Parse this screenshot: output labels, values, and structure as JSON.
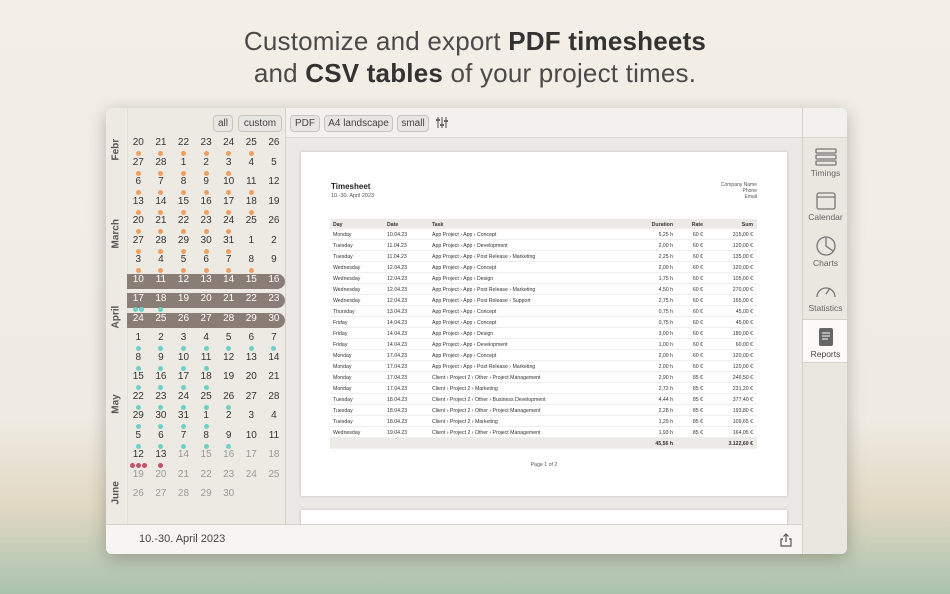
{
  "headline": {
    "l1_a": "Customize and export ",
    "l1_b": "PDF timesheets",
    "l2_a": "and ",
    "l2_b": "CSV tables",
    "l2_c": " of your project times."
  },
  "calendar": {
    "months": [
      "Febr",
      "March",
      "April",
      "May",
      "June"
    ],
    "range_label": "10.-30. April 2023",
    "filter": {
      "all": "all",
      "custom": "custom"
    },
    "weeks": [
      {
        "days": [
          "20",
          "21",
          "22",
          "23",
          "24",
          "25",
          "26"
        ],
        "dots": [
          "o",
          "o",
          "o",
          "o",
          "o",
          "o",
          ""
        ]
      },
      {
        "days": [
          "27",
          "28",
          "1",
          "2",
          "3",
          "4",
          "5"
        ],
        "dots": [
          "o",
          "o",
          "o",
          "o",
          "o",
          "",
          ""
        ],
        "dim": [
          false,
          false,
          false,
          false,
          false,
          false,
          false
        ]
      },
      {
        "days": [
          "6",
          "7",
          "8",
          "9",
          "10",
          "11",
          "12"
        ],
        "dots": [
          "o",
          "o",
          "o",
          "o",
          "o",
          "o",
          ""
        ]
      },
      {
        "days": [
          "13",
          "14",
          "15",
          "16",
          "17",
          "18",
          "19"
        ],
        "dots": [
          "o",
          "o",
          "o",
          "o",
          "o",
          "o",
          ""
        ]
      },
      {
        "days": [
          "20",
          "21",
          "22",
          "23",
          "24",
          "25",
          "26"
        ],
        "dots": [
          "o",
          "o",
          "o",
          "o",
          "o",
          "",
          ""
        ]
      },
      {
        "days": [
          "27",
          "28",
          "29",
          "30",
          "31",
          "1",
          "2"
        ],
        "dots": [
          "o",
          "o",
          "o",
          "o",
          "o",
          "",
          ""
        ]
      },
      {
        "days": [
          "3",
          "4",
          "5",
          "6",
          "7",
          "8",
          "9"
        ],
        "dots": [
          "o",
          "o",
          "o",
          "o",
          "o",
          "o",
          ""
        ]
      },
      {
        "days": [
          "10",
          "11",
          "12",
          "13",
          "14",
          "15",
          "16"
        ],
        "dots": [
          "",
          "",
          "",
          "",
          "",
          "",
          ""
        ],
        "sel": true
      },
      {
        "days": [
          "17",
          "18",
          "19",
          "20",
          "21",
          "22",
          "23"
        ],
        "dots": [
          "tt",
          "t",
          "",
          "",
          "",
          "",
          ""
        ],
        "sel": true
      },
      {
        "days": [
          "24",
          "25",
          "26",
          "27",
          "28",
          "29",
          "30"
        ],
        "dots": [
          "",
          "",
          "",
          "",
          "",
          "",
          ""
        ],
        "sel": true
      },
      {
        "days": [
          "1",
          "2",
          "3",
          "4",
          "5",
          "6",
          "7"
        ],
        "dots": [
          "t",
          "t",
          "t",
          "t",
          "t",
          "t",
          "t"
        ]
      },
      {
        "days": [
          "8",
          "9",
          "10",
          "11",
          "12",
          "13",
          "14"
        ],
        "dots": [
          "t",
          "t",
          "t",
          "t",
          "",
          "",
          ""
        ]
      },
      {
        "days": [
          "15",
          "16",
          "17",
          "18",
          "19",
          "20",
          "21"
        ],
        "dots": [
          "t",
          "t",
          "t",
          "t",
          "",
          "",
          ""
        ]
      },
      {
        "days": [
          "22",
          "23",
          "24",
          "25",
          "26",
          "27",
          "28"
        ],
        "dots": [
          "t",
          "t",
          "t",
          "t",
          "t",
          "",
          ""
        ]
      },
      {
        "days": [
          "29",
          "30",
          "31",
          "1",
          "2",
          "3",
          "4"
        ],
        "dots": [
          "t",
          "t",
          "t",
          "t",
          "",
          "",
          ""
        ]
      },
      {
        "days": [
          "5",
          "6",
          "7",
          "8",
          "9",
          "10",
          "11"
        ],
        "dots": [
          "t",
          "t",
          "t",
          "t",
          "t",
          "",
          ""
        ]
      },
      {
        "days": [
          "12",
          "13",
          "14",
          "15",
          "16",
          "17",
          "18"
        ],
        "dots": [
          "rrr",
          "r",
          "",
          "",
          "",
          "",
          ""
        ],
        "dimfrom": 2
      },
      {
        "days": [
          "19",
          "20",
          "21",
          "22",
          "23",
          "24",
          "25"
        ],
        "dots": [
          "",
          "",
          "",
          "",
          "",
          "",
          ""
        ],
        "dimfrom": 0
      },
      {
        "days": [
          "26",
          "27",
          "28",
          "29",
          "30"
        ],
        "dots": [
          "",
          "",
          "",
          "",
          ""
        ],
        "dimfrom": 0
      }
    ]
  },
  "toolbar": {
    "pdf": "PDF",
    "paper": "A4 landscape",
    "size": "small",
    "settings_icon": "sliders-icon"
  },
  "timesheet": {
    "title": "Timesheet",
    "range": "10.-30. April 2023",
    "company": [
      "Company Name",
      "Phone",
      "Email"
    ],
    "headers": [
      "Day",
      "Date",
      "Task",
      "Duration",
      "Rate",
      "Sum"
    ],
    "rows": [
      [
        "Monday",
        "10.04.23",
        "App Project › App › Concept",
        "5,25 h",
        "60 €",
        "315,00 €"
      ],
      [
        "Tuesday",
        "11.04.23",
        "App Project › App › Development",
        "2,00 h",
        "60 €",
        "120,00 €"
      ],
      [
        "Tuesday",
        "11.04.23",
        "App Project › App › Post Release › Marketing",
        "2,25 h",
        "60 €",
        "135,00 €"
      ],
      [
        "Wednesday",
        "12.04.23",
        "App Project › App › Concept",
        "2,00 h",
        "60 €",
        "120,00 €"
      ],
      [
        "Wednesday",
        "12.04.23",
        "App Project › App › Design",
        "1,75 h",
        "60 €",
        "105,00 €"
      ],
      [
        "Wednesday",
        "12.04.23",
        "App Project › App › Post Release › Marketing",
        "4,50 h",
        "60 €",
        "270,00 €"
      ],
      [
        "Wednesday",
        "12.04.23",
        "App Project › App › Post Release › Support",
        "2,75 h",
        "60 €",
        "165,00 €"
      ],
      [
        "Thursday",
        "13.04.23",
        "App Project › App › Concept",
        "0,75 h",
        "60 €",
        "45,00 €"
      ],
      [
        "Friday",
        "14.04.23",
        "App Project › App › Concept",
        "0,75 h",
        "60 €",
        "45,00 €"
      ],
      [
        "Friday",
        "14.04.23",
        "App Project › App › Design",
        "3,00 h",
        "60 €",
        "180,00 €"
      ],
      [
        "Friday",
        "14.04.23",
        "App Project › App › Development",
        "1,00 h",
        "60 €",
        "60,00 €"
      ],
      [
        "Monday",
        "17.04.23",
        "App Project › App › Concept",
        "2,00 h",
        "60 €",
        "120,00 €"
      ],
      [
        "Monday",
        "17.04.23",
        "App Project › App › Post Release › Marketing",
        "2,00 h",
        "60 €",
        "120,00 €"
      ],
      [
        "Monday",
        "17.04.23",
        "Client › Project 2 › Other › Project Management",
        "2,90 h",
        "85 €",
        "246,50 €"
      ],
      [
        "Monday",
        "17.04.23",
        "Client › Project 2 › Marketing",
        "2,72 h",
        "85 €",
        "231,20 €"
      ],
      [
        "Tuesday",
        "18.04.23",
        "Client › Project 2 › Other › Business Development",
        "4,44 h",
        "85 €",
        "377,40 €"
      ],
      [
        "Tuesday",
        "18.04.23",
        "Client › Project 2 › Other › Project Management",
        "2,28 h",
        "85 €",
        "193,80 €"
      ],
      [
        "Tuesday",
        "18.04.23",
        "Client › Project 2 › Marketing",
        "1,29 h",
        "85 €",
        "109,65 €"
      ],
      [
        "Wednesday",
        "19.04.23",
        "Client › Project 2 › Other › Project Management",
        "1,93 h",
        "85 €",
        "164,05 €"
      ]
    ],
    "total_duration": "45,56 h",
    "total_sum": "3.122,60 €",
    "page": "Page 1 of 2"
  },
  "sidebar": [
    {
      "label": "Timings",
      "icon": "timings-icon"
    },
    {
      "label": "Calendar",
      "icon": "calendar-icon"
    },
    {
      "label": "Charts",
      "icon": "pie-chart-icon"
    },
    {
      "label": "Statistics",
      "icon": "gauge-icon"
    },
    {
      "label": "Reports",
      "icon": "report-icon",
      "active": true
    }
  ],
  "share_icon": "share-icon",
  "colors": {
    "orange": "#f0a060",
    "teal": "#6fd0c8",
    "red": "#c8506a",
    "select": "#8a7d76"
  }
}
